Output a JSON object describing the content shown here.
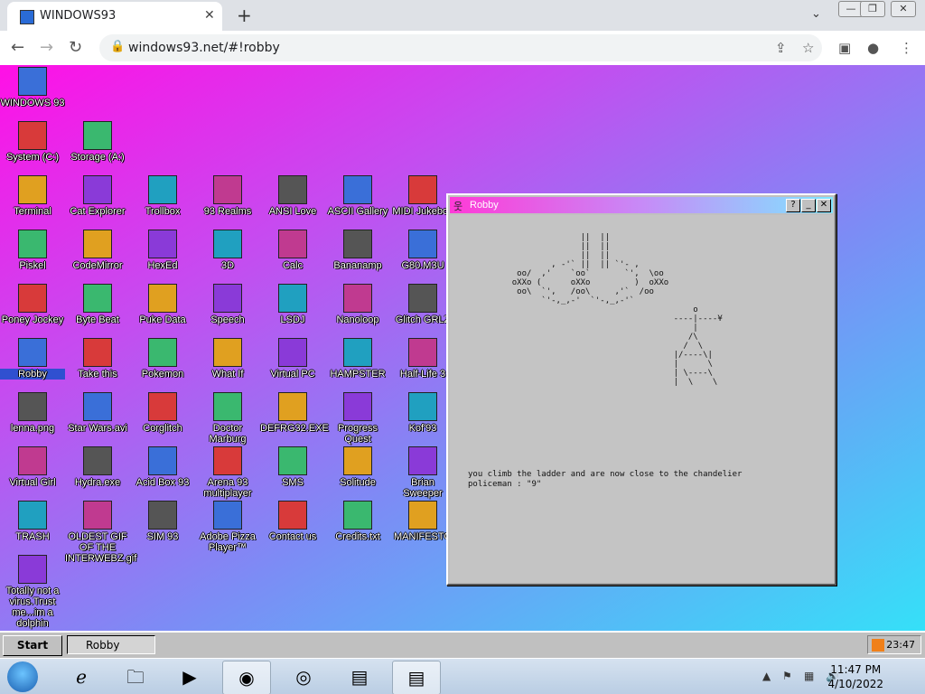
{
  "browser": {
    "tab_title": "WINDOWS93",
    "url": "windows93.net/#!robby"
  },
  "desktop_icons": [
    {
      "label": "WINDOWS 93",
      "icon": "computer-icon"
    },
    {
      "label": "System (C:)",
      "icon": "drive-icon"
    },
    {
      "label": "Storage (A:)",
      "icon": "floppy-drive-icon"
    },
    {
      "label": "Terminal",
      "icon": "terminal-icon"
    },
    {
      "label": "Cat Explorer",
      "icon": "cat-globe-icon"
    },
    {
      "label": "Trollbox",
      "icon": "trollbox-icon"
    },
    {
      "label": "93 Realms",
      "icon": "realms-icon"
    },
    {
      "label": "ANSI Love",
      "icon": "ansi-icon"
    },
    {
      "label": "ASCII Gallery",
      "icon": "ascii-icon"
    },
    {
      "label": "MIDI Jukebox",
      "icon": "midi-icon"
    },
    {
      "label": "Piskel",
      "icon": "palette-icon"
    },
    {
      "label": "CodeMirror",
      "icon": "codemirror-icon"
    },
    {
      "label": "HexEd",
      "icon": "cube-icon"
    },
    {
      "label": "3D",
      "icon": "teapot-icon"
    },
    {
      "label": "Calc",
      "icon": "calculator-icon"
    },
    {
      "label": "Bananamp",
      "icon": "banana-icon"
    },
    {
      "label": "G80.M3U",
      "icon": "audio-file-icon"
    },
    {
      "label": "Poney Jockey",
      "icon": "pony-icon"
    },
    {
      "label": "Byte Beat",
      "icon": "bytebeat-icon"
    },
    {
      "label": "Puke Data",
      "icon": "pd-icon"
    },
    {
      "label": "Speech",
      "icon": "face-icon"
    },
    {
      "label": "LSDJ",
      "icon": "gameboy-icon"
    },
    {
      "label": "Nanoloop",
      "icon": "nanoloop-icon"
    },
    {
      "label": "Glitch GRLZ",
      "icon": "lips-icon"
    },
    {
      "label": "Robby",
      "icon": "stickman-icon"
    },
    {
      "label": "Take this",
      "icon": "santa-icon"
    },
    {
      "label": "Pokemon",
      "icon": "pokemon-icon"
    },
    {
      "label": "What If",
      "icon": "whatif-icon"
    },
    {
      "label": "Virtual PC",
      "icon": "virtualpc-icon"
    },
    {
      "label": "HAMPSTER",
      "icon": "owl-icon"
    },
    {
      "label": "Half-Life 3",
      "icon": "lambda-icon"
    },
    {
      "label": "lenna.png",
      "icon": "image-file-icon"
    },
    {
      "label": "Star Wars.avi",
      "icon": "yoda-icon"
    },
    {
      "label": "Corglitch",
      "icon": "corgi-icon"
    },
    {
      "label": "Doctor Marburg",
      "icon": "doctor-icon"
    },
    {
      "label": "DEFRG32.EXE",
      "icon": "defrag-icon"
    },
    {
      "label": "Progress Quest",
      "icon": "swords-icon"
    },
    {
      "label": "Kof'93",
      "icon": "fighter-icon"
    },
    {
      "label": "Virtual Girl",
      "icon": "virtualgirl-icon"
    },
    {
      "label": "Hydra.exe",
      "icon": "hydra-icon"
    },
    {
      "label": "Acid Box 93",
      "icon": "smiley-icon"
    },
    {
      "label": "Arena 93 multiplayer",
      "icon": "arena-cube-icon"
    },
    {
      "label": "SMS",
      "icon": "sms-console-icon"
    },
    {
      "label": "Solitude",
      "icon": "bottle-icon"
    },
    {
      "label": "Brian Sweeper",
      "icon": "mine-icon"
    },
    {
      "label": "TRASH",
      "icon": "trash-icon"
    },
    {
      "label": "OLDEST GIF OF THE INTERWEBZ.gif",
      "icon": "gif-file-icon"
    },
    {
      "label": "SIM 93",
      "icon": "sim-icon"
    },
    {
      "label": "Adobe Pizza Player™",
      "icon": "pizza-icon"
    },
    {
      "label": "Contact us",
      "icon": "contact-icon"
    },
    {
      "label": "Credits.txt",
      "icon": "text-file-icon"
    },
    {
      "label": "MANIFESTO",
      "icon": "question-icon"
    },
    {
      "label": "Totally not a virus.Trust me...im a dolphin",
      "icon": "dolphin-icon"
    }
  ],
  "window": {
    "title": "Robby",
    "help_label": "?",
    "minimize_label": "_",
    "close_label": "✕",
    "ascii_art": "                       ||  ||\n                       ||  ||\n                       ||  ||\n                 , -'` ||  || `'- ,\n          oo/  ,'    `oo`       `',  \\oo\n         oXXo (      oXXo         )  oXXo\n          oo\\  `',   /oo\\     ,'`  /oo\n               `'-,_,-'  `'-,_,-'`\n                                              o\n                                          ----|----¥\n                                              |\n                                             /\\\n                                            /  \\\n                                          |/----\\|\n                                          |      \\\n                                          | \\----\\\n                                          |  \\    \\",
    "messages": [
      "you climb the ladder and are now close to the chandelier",
      "policeman : \"9\""
    ]
  },
  "taskbar93": {
    "start_label": "Start",
    "task_label": "Robby",
    "time": "23:47"
  },
  "taskbar7": {
    "time": "11:47 PM",
    "date": "4/10/2022"
  }
}
